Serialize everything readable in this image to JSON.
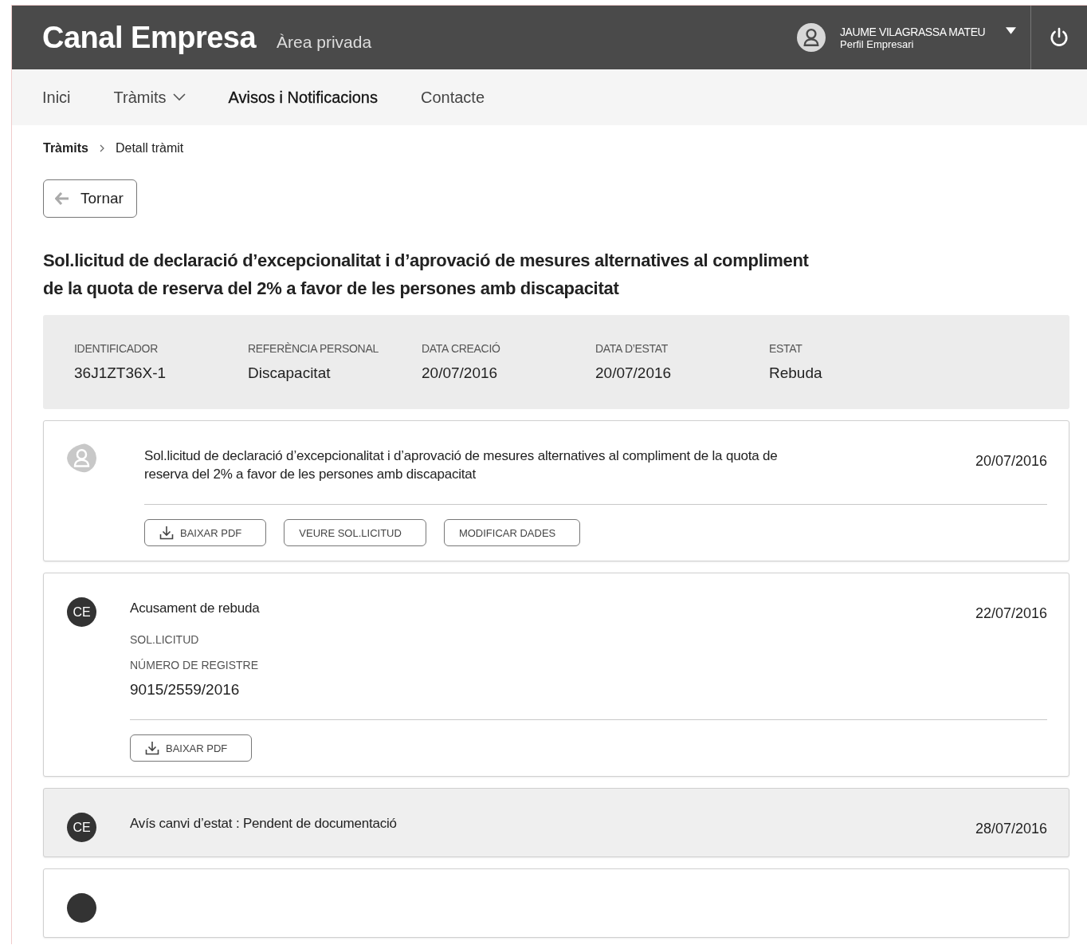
{
  "header": {
    "logo": "Canal Empresa",
    "subtitle": "Àrea privada",
    "user": {
      "name": "JAUME VILAGRASSA MATEU",
      "profile": "Perfil Empresari"
    }
  },
  "nav": [
    {
      "label": "Inici",
      "selected": false,
      "dropdown": false
    },
    {
      "label": "Tràmits",
      "selected": false,
      "dropdown": true
    },
    {
      "label": "Avisos i Notificacions",
      "selected": true,
      "dropdown": false
    },
    {
      "label": "Contacte",
      "selected": false,
      "dropdown": false
    }
  ],
  "breadcrumb": [
    "Tràmits",
    "Detall tràmit"
  ],
  "back_button": "Tornar",
  "title": "Sol.licitud de declaració d’excepcionalitat i d’aprovació de mesures alternatives al compliment de la quota de reserva del 2% a favor de les persones amb discapacitat",
  "summary": [
    {
      "label": "IDENTIFICADOR",
      "value": "36J1ZT36X-1"
    },
    {
      "label": "REFERÈNCIA PERSONAL",
      "value": "Discapacitat"
    },
    {
      "label": "DATA CREACIÓ",
      "value": "20/07/2016"
    },
    {
      "label": "DATA D’ESTAT",
      "value": "20/07/2016"
    },
    {
      "label": "ESTAT",
      "value": "Rebuda"
    }
  ],
  "events": [
    {
      "kind": "user",
      "highlighted": false,
      "title": "Sol.licitud de declaració d’excepcionalitat i d’aprovació de mesures alternatives al compliment de la quota de reserva del 2% a favor de les persones amb discapacitat",
      "date": "20/07/2016",
      "buttons": [
        {
          "label": "BAIXAR PDF",
          "kind": "download"
        },
        {
          "label": "VEURE SOL.LICITUD",
          "kind": "plain"
        },
        {
          "label": "MODIFICAR DADES",
          "kind": "plain"
        }
      ]
    },
    {
      "kind": "ce",
      "avatar": "CE",
      "highlighted": false,
      "title": "Acusament de rebuda",
      "date": "22/07/2016",
      "details": [
        {
          "label": "SOL.LICITUD"
        },
        {
          "label": "NÚMERO DE REGISTRE",
          "value": "9015/2559/2016"
        }
      ],
      "buttons": [
        {
          "label": "BAIXAR PDF",
          "kind": "download"
        }
      ]
    },
    {
      "kind": "ce",
      "avatar": "CE",
      "highlighted": true,
      "title": "Avís canvi d’estat : Pendent de documentació",
      "date": "28/07/2016"
    },
    {
      "kind": "ce",
      "highlighted": false
    }
  ]
}
